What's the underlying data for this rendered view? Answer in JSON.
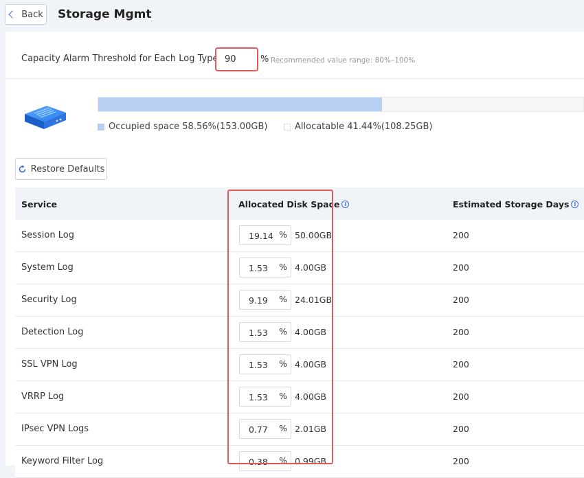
{
  "header": {
    "back_label": "Back",
    "title": "Storage Mgmt"
  },
  "threshold": {
    "label": "Capacity Alarm Threshold for Each Log Type:",
    "value": "90",
    "unit": "%",
    "hint": "Recommended value range: 80%–100%"
  },
  "usage": {
    "occupied_fraction": 0.5856,
    "occupied_label": "Occupied space 58.56%(153.00GB)",
    "allocatable_label": "Allocatable 41.44%(108.25GB)",
    "occupied_color": "#b7cff3"
  },
  "restore_label": "Restore Defaults",
  "table": {
    "headers": {
      "service": "Service",
      "allocated": "Allocated Disk Space",
      "days": "Estimated Storage Days"
    },
    "rows": [
      {
        "service": "Session Log",
        "pct": "19.14",
        "unit": "%",
        "gb": "50.00GB",
        "days": "200"
      },
      {
        "service": "System Log",
        "pct": "1.53",
        "unit": "%",
        "gb": "4.00GB",
        "days": "200"
      },
      {
        "service": "Security Log",
        "pct": "9.19",
        "unit": "%",
        "gb": "24.01GB",
        "days": "200"
      },
      {
        "service": "Detection Log",
        "pct": "1.53",
        "unit": "%",
        "gb": "4.00GB",
        "days": "200"
      },
      {
        "service": "SSL VPN Log",
        "pct": "1.53",
        "unit": "%",
        "gb": "4.00GB",
        "days": "200"
      },
      {
        "service": "VRRP Log",
        "pct": "1.53",
        "unit": "%",
        "gb": "4.00GB",
        "days": "200"
      },
      {
        "service": "IPsec VPN Logs",
        "pct": "0.77",
        "unit": "%",
        "gb": "2.01GB",
        "days": "200"
      },
      {
        "service": "Keyword Filter Log",
        "pct": "0.38",
        "unit": "%",
        "gb": "0.99GB",
        "days": "200"
      }
    ]
  },
  "icons": {
    "back": "chevron-left-icon",
    "restore": "refresh-icon",
    "info": "info-icon",
    "disk": "disk-icon"
  },
  "colors": {
    "accent": "#3a6fd8",
    "highlight": "#e05a5a"
  }
}
